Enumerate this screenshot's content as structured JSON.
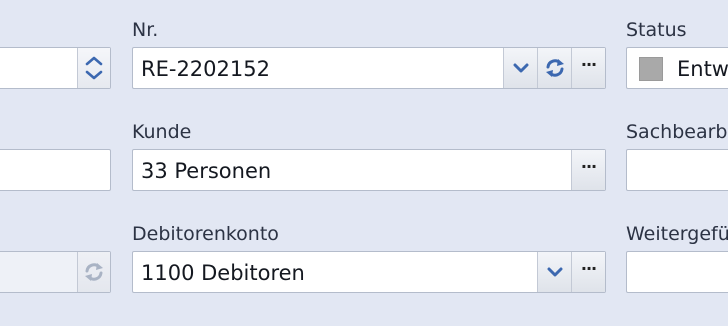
{
  "colors": {
    "background": "#e2e7f3",
    "field_border": "#b4bccb",
    "icon_blue": "#3c68b0"
  },
  "fields": {
    "nr": {
      "label": "Nr.",
      "value": "RE-2202152"
    },
    "status": {
      "label": "Status",
      "value": "Entw"
    },
    "kunde": {
      "label": "Kunde",
      "value": "33 Personen"
    },
    "sachbearbeiter": {
      "label": "Sachbearb",
      "value": ""
    },
    "debitorenkonto": {
      "label": "Debitorenkonto",
      "value": "1100 Debitoren"
    },
    "weitergefuehrt": {
      "label": "Weitergefü",
      "value": ""
    }
  },
  "buttons": {
    "more": "···"
  },
  "icons": {
    "spinner": "spinner-up-down-icon",
    "dropdown": "chevron-down-icon",
    "refresh": "refresh-icon",
    "checkbox": "status-square-icon"
  }
}
